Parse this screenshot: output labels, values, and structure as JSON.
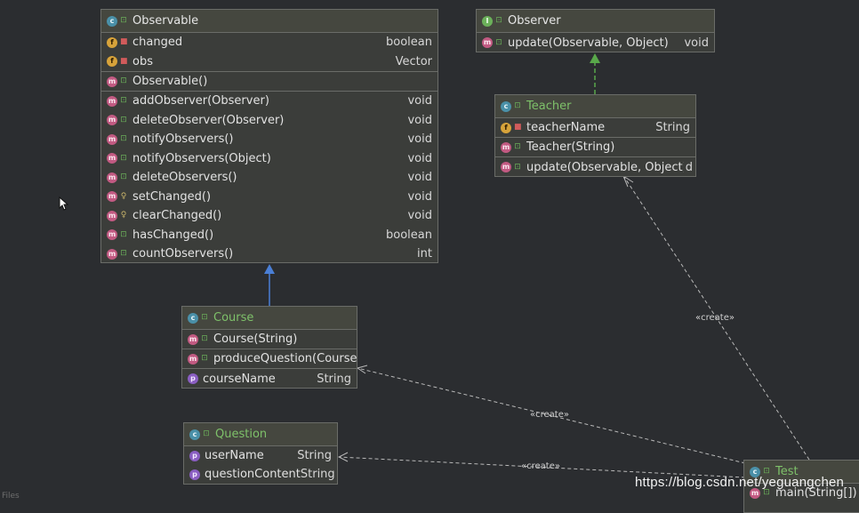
{
  "classes": {
    "observable": {
      "name": "Observable",
      "fields": [
        {
          "name": "changed",
          "type": "boolean"
        },
        {
          "name": "obs",
          "type": "Vector"
        }
      ],
      "constructors": [
        {
          "name": "Observable()",
          "type": ""
        }
      ],
      "methods": [
        {
          "name": "addObserver(Observer)",
          "type": "void"
        },
        {
          "name": "deleteObserver(Observer)",
          "type": "void"
        },
        {
          "name": "notifyObservers()",
          "type": "void"
        },
        {
          "name": "notifyObservers(Object)",
          "type": "void"
        },
        {
          "name": "deleteObservers()",
          "type": "void"
        },
        {
          "name": "setChanged()",
          "type": "void"
        },
        {
          "name": "clearChanged()",
          "type": "void"
        },
        {
          "name": "hasChanged()",
          "type": "boolean"
        },
        {
          "name": "countObservers()",
          "type": "int"
        }
      ]
    },
    "observer": {
      "name": "Observer",
      "methods": [
        {
          "name": "update(Observable, Object)",
          "type": "void"
        }
      ]
    },
    "teacher": {
      "name": "Teacher",
      "fields": [
        {
          "name": "teacherName",
          "type": "String"
        }
      ],
      "constructors": [
        {
          "name": "Teacher(String)",
          "type": ""
        }
      ],
      "methods": [
        {
          "name": "update(Observable, Object)",
          "type": "d"
        }
      ]
    },
    "course": {
      "name": "Course",
      "constructors": [
        {
          "name": "Course(String)",
          "type": ""
        }
      ],
      "methods": [
        {
          "name": "produceQuestion(Course",
          "type": ""
        }
      ],
      "properties": [
        {
          "name": "courseName",
          "type": "String"
        }
      ]
    },
    "question": {
      "name": "Question",
      "properties": [
        {
          "name": "userName",
          "type": "String"
        },
        {
          "name": "questionContent",
          "type": "String"
        }
      ]
    },
    "test": {
      "name": "Test",
      "methods": [
        {
          "name": "main(String[])",
          "type": ""
        }
      ]
    }
  },
  "edge_labels": {
    "test_teacher": "«create»",
    "test_course": "«create»",
    "test_question": "«create»"
  },
  "colors": {
    "background": "#2b2d30",
    "inheritance_arrow": "#4a7fd6",
    "implements_arrow": "#59a84a",
    "dependency_arrow": "#b9b9b9"
  },
  "watermark": "https://blog.csdn.net/yeguangchen",
  "corner_text": "Files"
}
